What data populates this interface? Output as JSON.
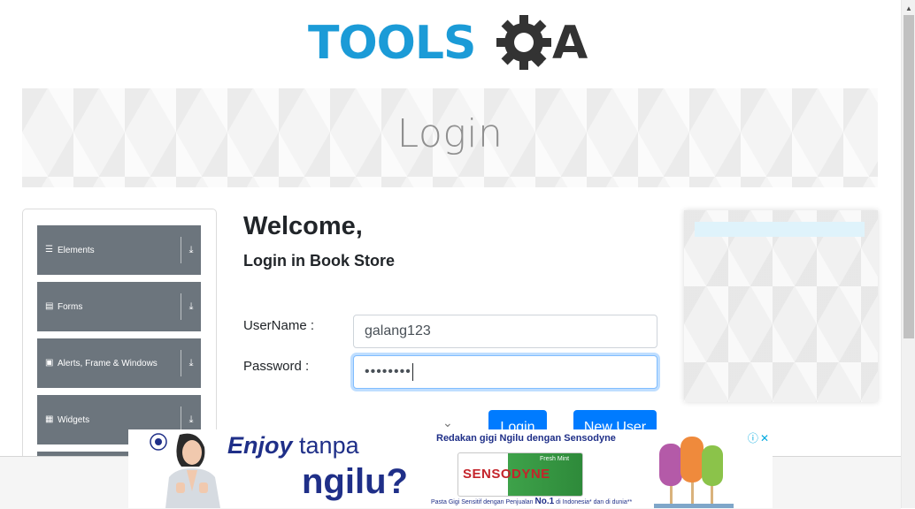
{
  "logo": {
    "text_tools": "TOOLS",
    "text_qa": "QA",
    "tools_color": "#1b9bd7",
    "qa_color": "#333333"
  },
  "banner": {
    "title": "Login"
  },
  "left_nav": {
    "groups": [
      {
        "label": "Elements",
        "icon": "hamburger-icon"
      },
      {
        "label": "Forms",
        "icon": "document-icon"
      },
      {
        "label": "Alerts, Frame & Windows",
        "icon": "window-icon"
      },
      {
        "label": "Widgets",
        "icon": "grid-icon"
      }
    ],
    "expand_icon": "download-arrow-icon",
    "background": "#6c757d"
  },
  "form": {
    "welcome": "Welcome,",
    "subtitle": "Login in Book Store",
    "username_label": "UserName :",
    "username_value": "galang123",
    "password_label": "Password :",
    "password_value": "••••••••",
    "login_button": "Login",
    "new_user_button": "New User",
    "accent": "#007bff"
  },
  "ad": {
    "enjoy": "Enjoy",
    "tanpa": "tanpa",
    "ngilu": "ngilu?",
    "headline": "Redakan gigi Ngilu dengan Sensodyne",
    "brand": "SENSODYNE",
    "variant": "Fresh Mint",
    "footnote_prefix": "Pasta Gigi Sensitif dengan Penjualan",
    "footnote_rank": "No.1",
    "footnote_suffix": "di Indonesia* dan di dunia**",
    "info_icon": "info-icon",
    "close_icon": "close-icon"
  }
}
